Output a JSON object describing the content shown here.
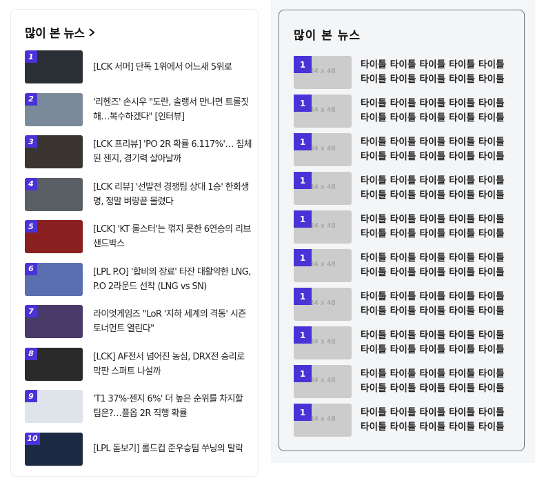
{
  "left": {
    "title": "많이 본 뉴스",
    "items": [
      {
        "rank": "1",
        "title": "[LCK 서머] 단독 1위에서 어느새 5위로",
        "thumb_color": "#2b2f36"
      },
      {
        "rank": "2",
        "title": "'리헨즈' 손시우 \"도란, 솔랭서 만나면 트롤짓 해…복수하겠다\" [인터뷰]",
        "thumb_color": "#7a8a9a"
      },
      {
        "rank": "3",
        "title": "[LCK 프리뷰] 'PO 2R 확률 6.117%'… 침체된 젠지, 경기력 살아날까",
        "thumb_color": "#3a3530"
      },
      {
        "rank": "4",
        "title": "[LCK 리뷰] '선발전 경쟁팀 상대 1승' 한화생명, 정말 벼랑끝 몰렸다",
        "thumb_color": "#5a5f66"
      },
      {
        "rank": "5",
        "title": "[LCK] 'KT 롤스터'는 꺾지 못한 6연승의 리브 샌드박스",
        "thumb_color": "#8a1f1f"
      },
      {
        "rank": "6",
        "title": "[LPL P.O] '합비의 장료' 타잔 대활약한 LNG, P.O 2라운드 선착 (LNG vs SN)",
        "thumb_color": "#5a6fb0"
      },
      {
        "rank": "7",
        "title": "라이엇게임즈 \"LoR '지하 세계의 격동' 시즌 토너먼트 열린다\"",
        "thumb_color": "#4a3a6a"
      },
      {
        "rank": "8",
        "title": "[LCK] AF전서 넘어진 농심, DRX전 승리로 막판 스퍼트 나설까",
        "thumb_color": "#2a2a2a"
      },
      {
        "rank": "9",
        "title": "'T1 37%·젠지 6%' 더 높은 순위를 차지할 팀은?…플옵 2R 직행 확률",
        "thumb_color": "#dfe3ea"
      },
      {
        "rank": "10",
        "title": "[LPL 돋보기] 롤드컵 준우승팀 쑤닝의 탈락",
        "thumb_color": "#1c2a44"
      }
    ]
  },
  "right": {
    "title": "많이 본 뉴스",
    "placeholder_label": "84 x 48",
    "items": [
      {
        "rank": "1",
        "title": "타이틀 타이틀 타이틀 타이틀 타이틀 타이틀 타이틀 타이틀 타이틀 타이틀"
      },
      {
        "rank": "1",
        "title": "타이틀 타이틀 타이틀 타이틀 타이틀 타이틀 타이틀 타이틀 타이틀 타이틀"
      },
      {
        "rank": "1",
        "title": "타이틀 타이틀 타이틀 타이틀 타이틀 타이틀 타이틀 타이틀 타이틀 타이틀"
      },
      {
        "rank": "1",
        "title": "타이틀 타이틀 타이틀 타이틀 타이틀 타이틀 타이틀 타이틀 타이틀 타이틀"
      },
      {
        "rank": "1",
        "title": "타이틀 타이틀 타이틀 타이틀 타이틀 타이틀 타이틀 타이틀 타이틀 타이틀"
      },
      {
        "rank": "1",
        "title": "타이틀 타이틀 타이틀 타이틀 타이틀 타이틀 타이틀 타이틀 타이틀 타이틀"
      },
      {
        "rank": "1",
        "title": "타이틀 타이틀 타이틀 타이틀 타이틀 타이틀 타이틀 타이틀 타이틀 타이틀"
      },
      {
        "rank": "1",
        "title": "타이틀 타이틀 타이틀 타이틀 타이틀 타이틀 타이틀 타이틀 타이틀 타이틀"
      },
      {
        "rank": "1",
        "title": "타이틀 타이틀 타이틀 타이틀 타이틀 타이틀 타이틀 타이틀 타이틀 타이틀"
      },
      {
        "rank": "1",
        "title": "타이틀 타이틀 타이틀 타이틀 타이틀 타이틀 타이틀 타이틀 타이틀 타이틀"
      }
    ]
  },
  "colors": {
    "accent": "#4a33d6",
    "placeholder": "#cccccc",
    "panel_border": "#707070"
  },
  "icons": {
    "title_arrow": "chevron-right-icon"
  }
}
